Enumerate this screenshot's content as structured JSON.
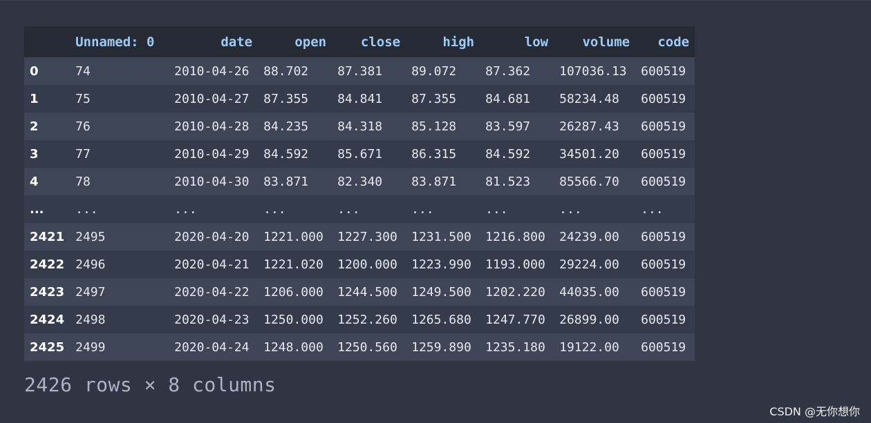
{
  "dataframe": {
    "columns": [
      "Unnamed: 0",
      "date",
      "open",
      "close",
      "high",
      "low",
      "volume",
      "code"
    ],
    "rows": [
      {
        "index": "0",
        "cells": [
          "74",
          "2010-04-26",
          "88.702",
          "87.381",
          "89.072",
          "87.362",
          "107036.13",
          "600519"
        ]
      },
      {
        "index": "1",
        "cells": [
          "75",
          "2010-04-27",
          "87.355",
          "84.841",
          "87.355",
          "84.681",
          "58234.48",
          "600519"
        ]
      },
      {
        "index": "2",
        "cells": [
          "76",
          "2010-04-28",
          "84.235",
          "84.318",
          "85.128",
          "83.597",
          "26287.43",
          "600519"
        ]
      },
      {
        "index": "3",
        "cells": [
          "77",
          "2010-04-29",
          "84.592",
          "85.671",
          "86.315",
          "84.592",
          "34501.20",
          "600519"
        ]
      },
      {
        "index": "4",
        "cells": [
          "78",
          "2010-04-30",
          "83.871",
          "82.340",
          "83.871",
          "81.523",
          "85566.70",
          "600519"
        ]
      },
      {
        "index": "...",
        "cells": [
          "...",
          "...",
          "...",
          "...",
          "...",
          "...",
          "...",
          "..."
        ]
      },
      {
        "index": "2421",
        "cells": [
          "2495",
          "2020-04-20",
          "1221.000",
          "1227.300",
          "1231.500",
          "1216.800",
          "24239.00",
          "600519"
        ]
      },
      {
        "index": "2422",
        "cells": [
          "2496",
          "2020-04-21",
          "1221.020",
          "1200.000",
          "1223.990",
          "1193.000",
          "29224.00",
          "600519"
        ]
      },
      {
        "index": "2423",
        "cells": [
          "2497",
          "2020-04-22",
          "1206.000",
          "1244.500",
          "1249.500",
          "1202.220",
          "44035.00",
          "600519"
        ]
      },
      {
        "index": "2424",
        "cells": [
          "2498",
          "2020-04-23",
          "1250.000",
          "1252.260",
          "1265.680",
          "1247.770",
          "26899.00",
          "600519"
        ]
      },
      {
        "index": "2425",
        "cells": [
          "2499",
          "2020-04-24",
          "1248.000",
          "1250.560",
          "1259.890",
          "1235.180",
          "19122.00",
          "600519"
        ]
      }
    ],
    "shape_text": "2426 rows × 8 columns"
  },
  "watermark": "CSDN @无你想你",
  "colors": {
    "background": "#2f3542",
    "header_background": "#252a35",
    "header_text": "#9ecbf5",
    "row_odd": "#3d4556",
    "row_even": "#343b4b",
    "cell_text": "#e4e8ef",
    "shape_text": "#aab4c4"
  }
}
